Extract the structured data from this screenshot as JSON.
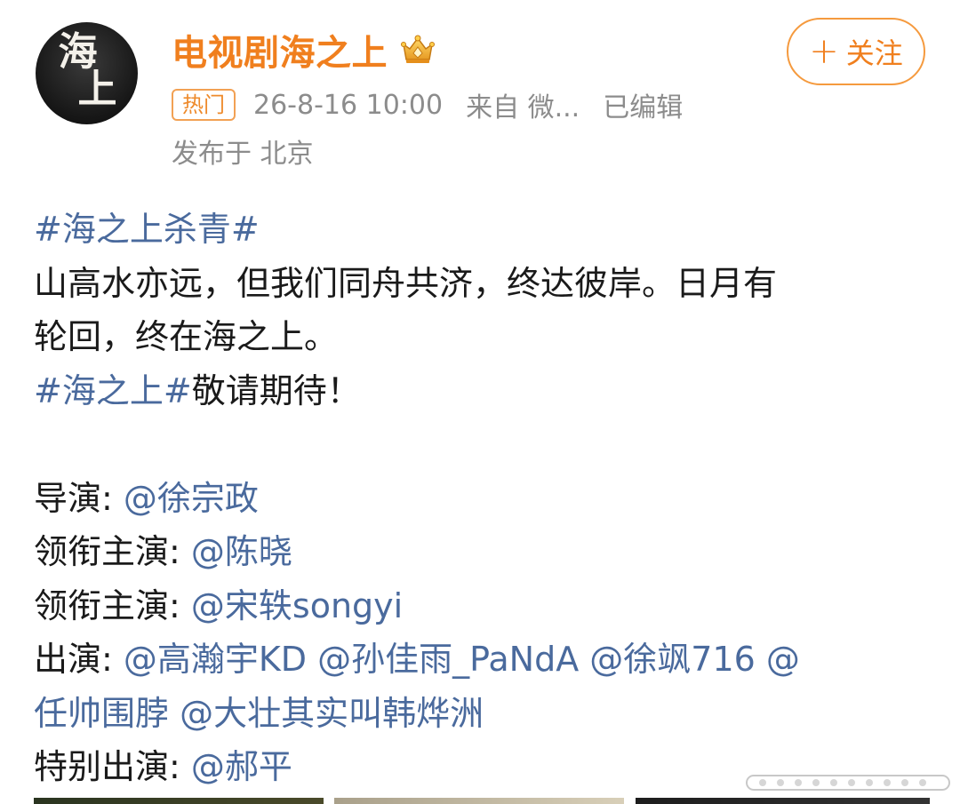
{
  "account": {
    "avatar_text_line1": "海",
    "avatar_text_line2": "上",
    "username": "电视剧海之上",
    "badge_icon": "crown-vip-icon"
  },
  "follow_button": {
    "plus": "+",
    "label": "关注"
  },
  "meta": {
    "hot_label": "热门",
    "time": "26-8-16 10:00",
    "source": "来自 微...",
    "edited": "已编辑",
    "location": "发布于 北京"
  },
  "content": {
    "tag1": "#海之上杀青#",
    "para1_line1": "山高水亦远，但我们同舟共济，终达彼岸。日月有",
    "para1_line2": "轮回，终在海之上。",
    "tag2": "#海之上#",
    "para2_suffix": "敬请期待！",
    "director_label": "导演: ",
    "director_mention": "@徐宗政",
    "lead1_label": "领衔主演: ",
    "lead1_mention": "@陈晓",
    "lead2_label": "领衔主演: ",
    "lead2_mention": "@宋轶songyi",
    "cast_label": "出演: ",
    "cast_line1_mentions": "@高瀚宇KD @孙佳雨_PaNdA @徐飒716 @",
    "cast_line2_mentions": "任帅围脖 @大壮其实叫韩烨洲",
    "special_label": "特别出演: ",
    "special_mention": "@郝平"
  },
  "colors": {
    "username": "#f07f1e",
    "link": "#4a6a9d",
    "meta": "#8c8c8c",
    "text": "#1a1a1a"
  }
}
